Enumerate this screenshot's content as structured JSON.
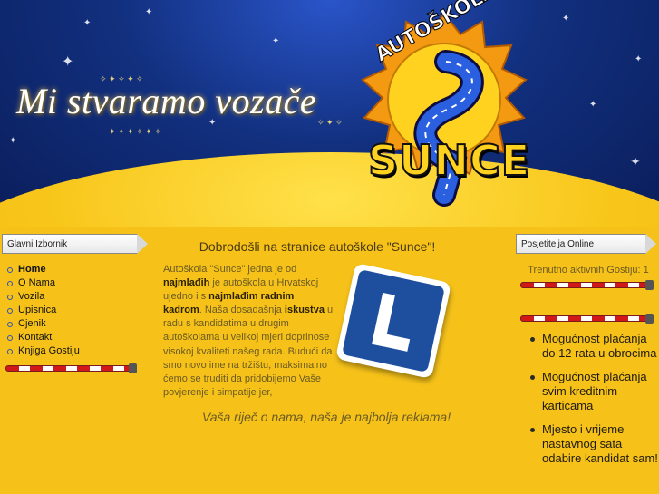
{
  "header": {
    "slogan": "Mi stvaramo vozače",
    "logo_arc_text": "AUTOŠKOLA",
    "logo_wordmark": "SUNCE"
  },
  "left_menu": {
    "title": "Glavni Izbornik",
    "items": [
      {
        "label": "Home",
        "active": true
      },
      {
        "label": "O Nama",
        "active": false
      },
      {
        "label": "Vozila",
        "active": false
      },
      {
        "label": "Upisnica",
        "active": false
      },
      {
        "label": "Cjenik",
        "active": false
      },
      {
        "label": "Kontakt",
        "active": false
      },
      {
        "label": "Knjiga Gostiju",
        "active": false
      }
    ]
  },
  "main": {
    "heading": "Dobrodošli na stranice autoškole \"Sunce\"!",
    "intro_parts": [
      {
        "text": "Autoškola \"Sunce\" jedna je od ",
        "bold": false
      },
      {
        "text": "najmlađih",
        "bold": true
      },
      {
        "text": " je autoškola u Hrvatskoj ujedno i s ",
        "bold": false
      },
      {
        "text": "najmlađim radnim kadrom",
        "bold": true
      },
      {
        "text": ". Naša dosadašnja ",
        "bold": false
      },
      {
        "text": "iskustva",
        "bold": true
      },
      {
        "text": " u radu s kandidatima u drugim autoškolama u velikoj mjeri doprinose visokoj kvaliteti našeg rada. Budući da smo novo ime na tržištu, maksimalno ćemo se truditi da pridobijemo Vaše povjerenje i simpatije jer,",
        "bold": false
      }
    ],
    "motto": "Vaša riječ o nama, naša je najbolja reklama!",
    "sign_letter": "L"
  },
  "right_panel": {
    "title": "Posjetitelja Online",
    "guests_text": "Trenutno aktivnih Gostiju: 1",
    "features": [
      "Mogućnost plaćanja do 12 rata u obrocima",
      "Mogućnost plaćanja svim kreditnim karticama",
      "Mjesto i vrijeme nastavnog sata odabire kandidat sam!"
    ]
  },
  "colors": {
    "sky": "#12307f",
    "sun_yellow": "#f6c21a",
    "barrier_red": "#d01818",
    "sign_blue": "#1d4f9e"
  }
}
